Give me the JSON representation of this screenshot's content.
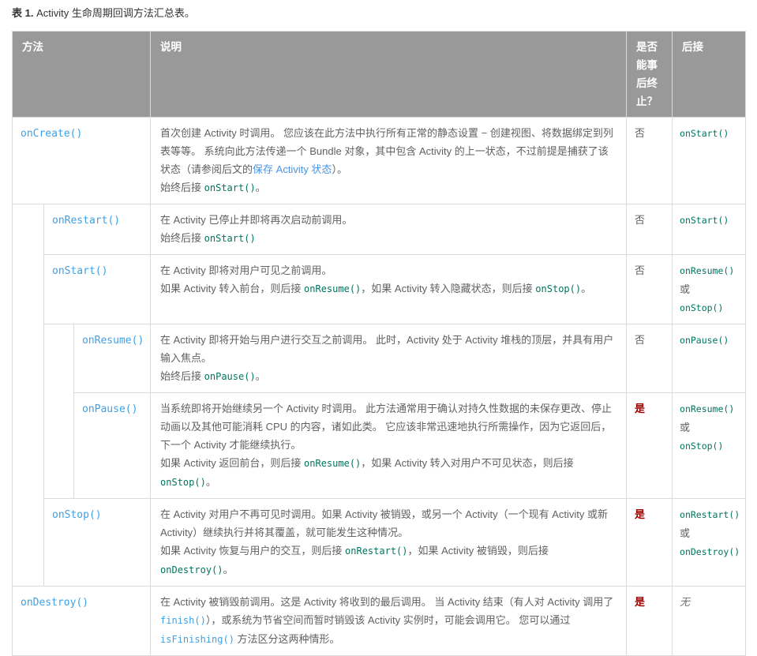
{
  "caption": {
    "label": "表 1.",
    "text": " Activity 生命周期回调方法汇总表。"
  },
  "colors": {
    "header_bg": "#999999",
    "border": "#dbdbdb",
    "body_text": "#616161",
    "code_green": "#00755e",
    "link_blue": "#4596ea",
    "code_link_blue": "#3ca1e8",
    "killable_red": "#990000",
    "title": "#333333"
  },
  "table": {
    "headers": [
      "方法",
      "说明",
      "是否能事后终止？",
      "后接"
    ],
    "rows": [
      {
        "method": "onCreate()",
        "indent": 0,
        "description": [
          [
            {
              "t": "text",
              "s": "首次创建 Activity 时调用。 您应该在此方法中执行所有正常的静态设置 − 创建视图、将数据绑定到列表等等。 系统向此方法传递一个 Bundle 对象，其中包含 Activity 的上一状态，不过前提是捕获了该状态（请参阅后文的"
            },
            {
              "t": "link",
              "s": "保存 Activity 状态"
            },
            {
              "t": "text",
              "s": "）。"
            }
          ],
          [
            {
              "t": "text",
              "s": "始终后接 "
            },
            {
              "t": "code",
              "s": "onStart()"
            },
            {
              "t": "text",
              "s": "。"
            }
          ]
        ],
        "killable": "否",
        "next": [
          {
            "t": "code",
            "s": "onStart()"
          }
        ]
      },
      {
        "method": "onRestart()",
        "indent": 1,
        "spacer_rowspan": 5,
        "description": [
          [
            {
              "t": "text",
              "s": "在 Activity 已停止并即将再次启动前调用。"
            }
          ],
          [
            {
              "t": "text",
              "s": "始终后接 "
            },
            {
              "t": "code",
              "s": "onStart()"
            }
          ]
        ],
        "killable": "否",
        "next": [
          {
            "t": "code",
            "s": "onStart()"
          }
        ]
      },
      {
        "method": "onStart()",
        "indent": 1,
        "description": [
          [
            {
              "t": "text",
              "s": "在 Activity 即将对用户可见之前调用。"
            }
          ],
          [
            {
              "t": "text",
              "s": "如果 Activity 转入前台，则后接 "
            },
            {
              "t": "code",
              "s": "onResume()"
            },
            {
              "t": "text",
              "s": "，如果 Activity 转入隐藏状态，则后接 "
            },
            {
              "t": "code",
              "s": "onStop()"
            },
            {
              "t": "text",
              "s": "。"
            }
          ]
        ],
        "killable": "否",
        "next": [
          {
            "t": "code",
            "s": "onResume()"
          },
          {
            "t": "text",
            "s": "或"
          },
          {
            "t": "code",
            "s": "onStop()"
          }
        ]
      },
      {
        "method": "onResume()",
        "indent": 2,
        "spacer_rowspan": 2,
        "description": [
          [
            {
              "t": "text",
              "s": "在 Activity 即将开始与用户进行交互之前调用。 此时，Activity 处于 Activity 堆栈的顶层，并具有用户输入焦点。"
            }
          ],
          [
            {
              "t": "text",
              "s": "始终后接 "
            },
            {
              "t": "code",
              "s": "onPause()"
            },
            {
              "t": "text",
              "s": "。"
            }
          ]
        ],
        "killable": "否",
        "next": [
          {
            "t": "code",
            "s": "onPause()"
          }
        ]
      },
      {
        "method": "onPause()",
        "indent": 2,
        "description": [
          [
            {
              "t": "text",
              "s": "当系统即将开始继续另一个 Activity 时调用。 此方法通常用于确认对持久性数据的未保存更改、停止动画以及其他可能消耗 CPU 的内容，诸如此类。 它应该非常迅速地执行所需操作，因为它返回后，下一个 Activity 才能继续执行。"
            }
          ],
          [
            {
              "t": "text",
              "s": "如果 Activity 返回前台，则后接 "
            },
            {
              "t": "code",
              "s": "onResume()"
            },
            {
              "t": "text",
              "s": "，如果 Activity 转入对用户不可见状态，则后接 "
            },
            {
              "t": "code",
              "s": "onStop()"
            },
            {
              "t": "text",
              "s": "。"
            }
          ]
        ],
        "killable": "是",
        "next": [
          {
            "t": "code",
            "s": "onResume()"
          },
          {
            "t": "text",
            "s": "或"
          },
          {
            "t": "code",
            "s": "onStop()"
          }
        ]
      },
      {
        "method": "onStop()",
        "indent": 1,
        "description": [
          [
            {
              "t": "text",
              "s": "在 Activity 对用户不再可见时调用。如果 Activity 被销毁，或另一个 Activity（一个现有 Activity 或新 Activity）继续执行并将其覆盖，就可能发生这种情况。"
            }
          ],
          [
            {
              "t": "text",
              "s": "如果 Activity 恢复与用户的交互，则后接 "
            },
            {
              "t": "code",
              "s": "onRestart()"
            },
            {
              "t": "text",
              "s": "，如果 Activity 被销毁，则后接 "
            },
            {
              "t": "code",
              "s": "onDestroy()"
            },
            {
              "t": "text",
              "s": "。"
            }
          ]
        ],
        "killable": "是",
        "next": [
          {
            "t": "code",
            "s": "onRestart()"
          },
          {
            "t": "text",
            "s": "或"
          },
          {
            "t": "code",
            "s": "onDestroy()"
          }
        ]
      },
      {
        "method": "onDestroy()",
        "indent": 0,
        "description": [
          [
            {
              "t": "text",
              "s": "在 Activity 被销毁前调用。这是 Activity 将收到的最后调用。 当 Activity 结束（有人对 Activity 调用了 "
            },
            {
              "t": "codelink",
              "s": "finish()"
            },
            {
              "t": "text",
              "s": "），或系统为节省空间而暂时销毁该 Activity 实例时，可能会调用它。 您可以通过 "
            },
            {
              "t": "codelink",
              "s": "isFinishing()"
            },
            {
              "t": "text",
              "s": " 方法区分这两种情形。"
            }
          ]
        ],
        "killable": "是",
        "next": [
          {
            "t": "em",
            "s": "无"
          }
        ]
      }
    ]
  }
}
